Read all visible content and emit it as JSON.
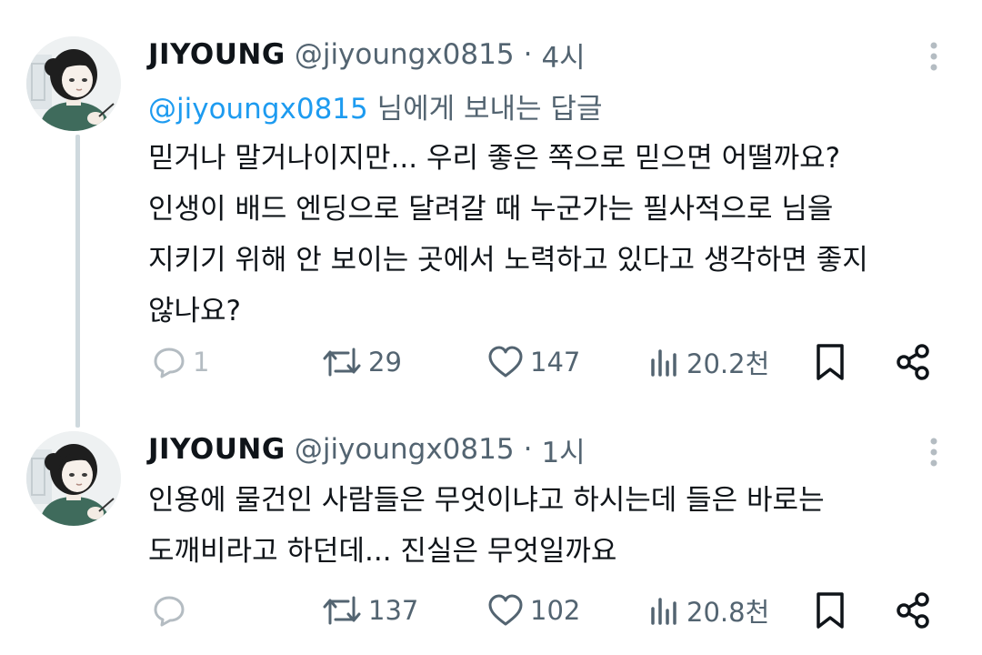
{
  "tweets": [
    {
      "author_name": "JIYOUNG",
      "handle": "@jiyoungx0815",
      "separator": "·",
      "time": "4시",
      "reply_to": {
        "mention": "@jiyoungx0815",
        "suffix": " 님에게 보내는 답글"
      },
      "text_lines": [
        "믿거나 말거나이지만... 우리 좋은 쪽으로 믿으면 어떨까요?",
        "인생이 배드 엔딩으로 달려갈 때 누군가는 필사적으로 님을",
        "지키기 위해 안 보이는 곳에서 노력하고 있다고 생각하면 좋지",
        "않나요?"
      ],
      "replies": "1",
      "retweets": "29",
      "likes": "147",
      "views": "20.2천"
    },
    {
      "author_name": "JIYOUNG",
      "handle": "@jiyoungx0815",
      "separator": "·",
      "time": "1시",
      "text_lines": [
        "인용에 물건인 사람들은 무엇이냐고 하시는데 들은 바로는",
        "도깨비라고 하던데... 진실은 무엇일까요"
      ],
      "retweets": "137",
      "likes": "102",
      "views": "20.8천"
    }
  ],
  "icons": {
    "reply": "speech-bubble-icon",
    "retweet": "retweet-arrows-icon",
    "like": "heart-icon",
    "views": "bar-chart-icon",
    "bookmark": "bookmark-icon",
    "share": "share-icon",
    "more": "vertical-dots-icon"
  },
  "colors": {
    "text": "#0f1419",
    "secondary": "#536471",
    "mention": "#1d9bf0",
    "thread_line": "#cfd9de"
  }
}
